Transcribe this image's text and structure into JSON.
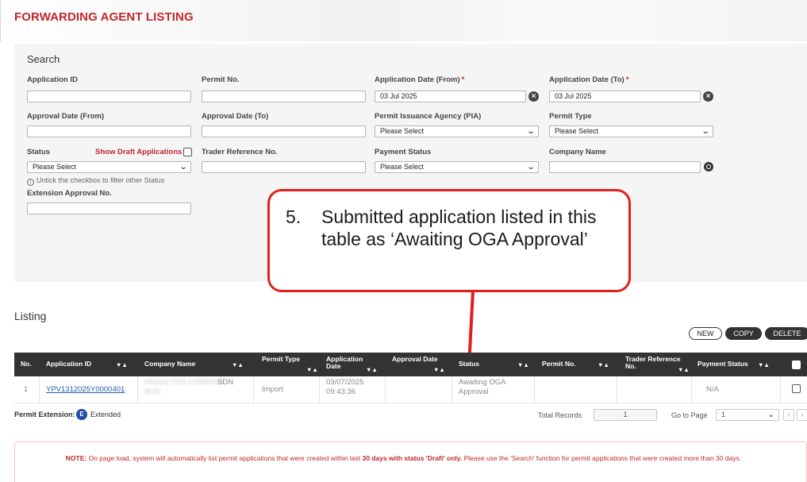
{
  "page_title": "FORWARDING AGENT LISTING",
  "search": {
    "title": "Search",
    "application_id_label": "Application ID",
    "permit_no_label": "Permit No.",
    "app_date_from_label": "Application Date (From)",
    "app_date_from_value": "03 Jul 2025",
    "app_date_to_label": "Application Date (To)",
    "app_date_to_value": "03 Jul 2025",
    "required_mark": "*",
    "approval_date_from_label": "Approval Date (From)",
    "approval_date_to_label": "Approval Date (To)",
    "pia_label": "Permit Issuance Agency (PIA)",
    "pia_value": "Please Select",
    "permit_type_label": "Permit Type",
    "permit_type_value": "Please Select",
    "status_label": "Status",
    "status_value": "Please Select",
    "show_draft_label": "Show Draft Applications",
    "trader_ref_label": "Trader Reference No.",
    "payment_status_label": "Payment Status",
    "payment_status_value": "Please Select",
    "company_name_label": "Company Name",
    "hint": "Untick the checkbox to filter other Status",
    "extension_label": "Extension Approval No."
  },
  "callout": {
    "number": "5.",
    "text": "Submitted application listed in this table as ‘Awaiting OGA Approval’",
    "color": "#e02020"
  },
  "listing": {
    "title": "Listing",
    "buttons": {
      "new": "NEW",
      "copy": "COPY",
      "delete": "DELETE"
    },
    "sort_arrows": "▼▲",
    "columns": {
      "no": "No.",
      "application_id": "Application ID",
      "company_name": "Company Name",
      "permit_type": "Permit Type",
      "application_date": [
        "Application",
        "Date"
      ],
      "approval_date": "Approval Date",
      "status": "Status",
      "permit_no": "Permit No.",
      "trader_ref": [
        "Trader Reference",
        "No."
      ],
      "payment_status": "Payment Status"
    },
    "rows": [
      {
        "no": "1",
        "application_id": "YPV1312025Y0000401",
        "company_name_redacted": "REDACTED COMPANY",
        "company_name_suffix": [
          "SDN",
          "BHD"
        ],
        "permit_type": "Import",
        "application_date": [
          "03/07/2025",
          "09:43:36"
        ],
        "approval_date": "",
        "status": [
          "Awaiting OGA",
          "Approval"
        ],
        "permit_no": "",
        "trader_ref": "",
        "payment_status": "N/A"
      }
    ]
  },
  "footer": {
    "permit_extension_label": "Permit Extension:",
    "badge": "E",
    "extended": "Extended",
    "total_records_label": "Total Records",
    "total_records": "1",
    "go_to_page_label": "Go to Page",
    "page": "1"
  },
  "note": {
    "prefix": "NOTE:",
    "part1": " On page load, system will automatically list permit applications that were created within last ",
    "bold": "30 days with status 'Draft' only.",
    "part2": " Please use the 'Search' function for permit applications that were created more than 30 days."
  },
  "colors": {
    "brand_red": "#c1272d",
    "header_dark": "#333333",
    "link_blue": "#1d5fa7"
  }
}
